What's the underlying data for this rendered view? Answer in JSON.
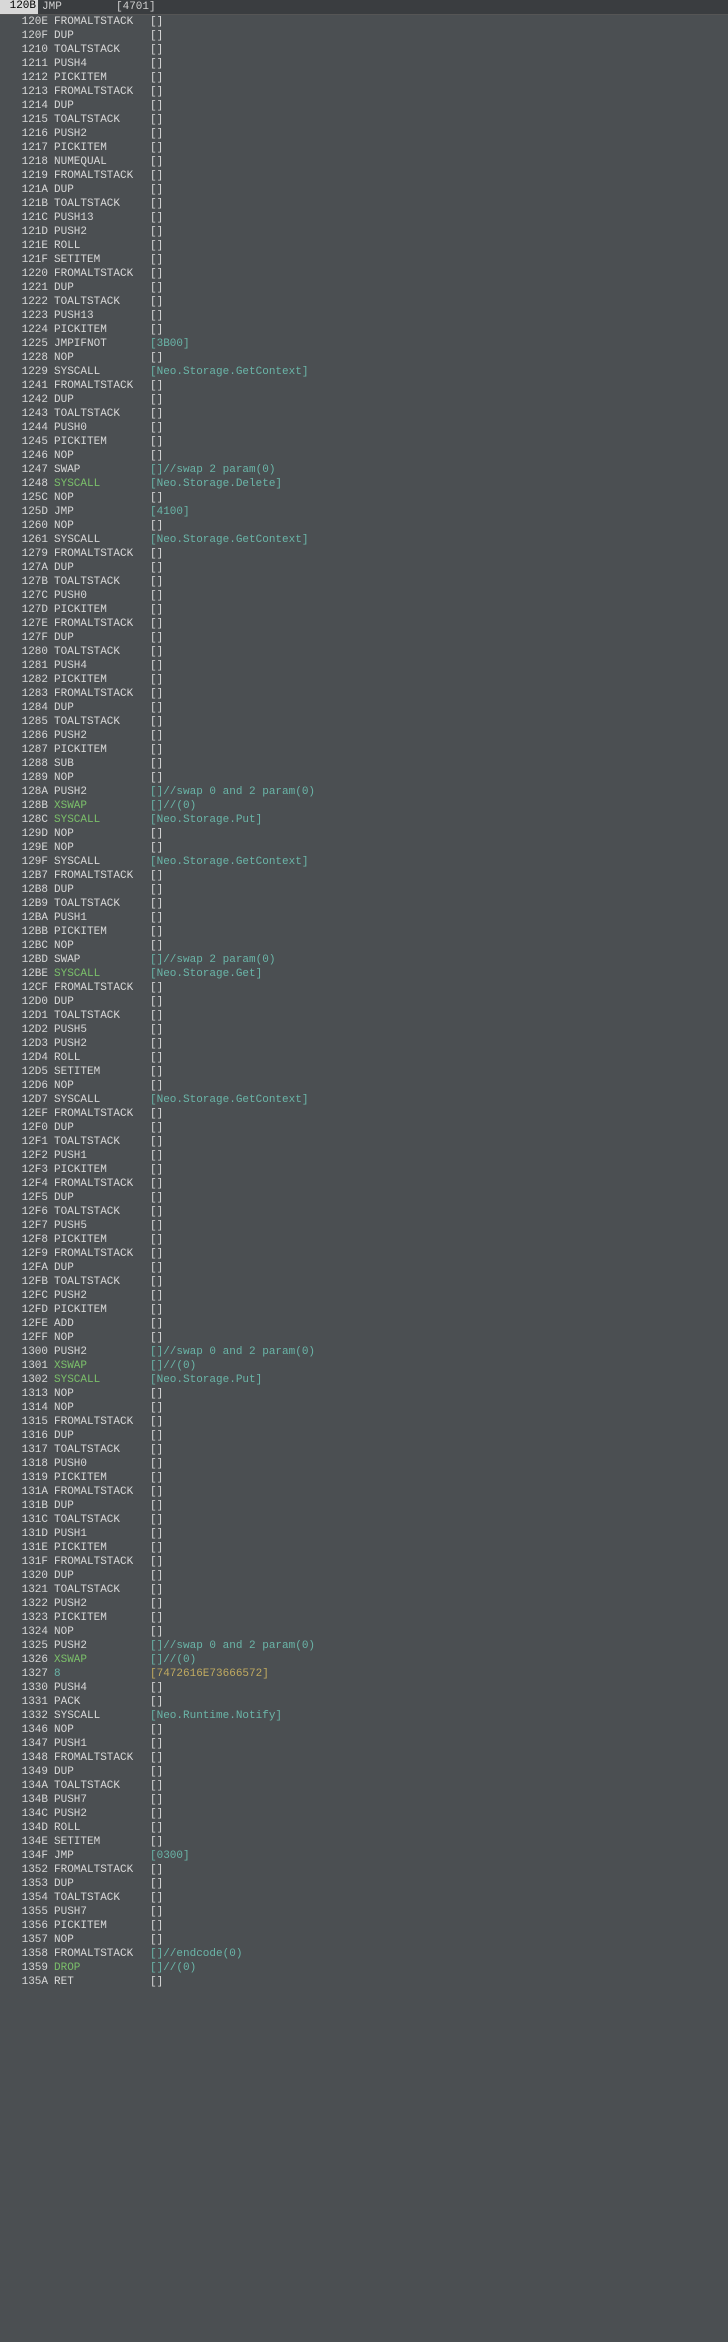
{
  "header": {
    "addr": "120B",
    "op": "JMP",
    "arg": "[4701]"
  },
  "rows": [
    {
      "addr": "120E",
      "op": "FROMALTSTACK",
      "arg": "[]"
    },
    {
      "addr": "120F",
      "op": "DUP",
      "arg": "[]"
    },
    {
      "addr": "1210",
      "op": "TOALTSTACK",
      "arg": "[]"
    },
    {
      "addr": "1211",
      "op": "PUSH4",
      "arg": "[]"
    },
    {
      "addr": "1212",
      "op": "PICKITEM",
      "arg": "[]"
    },
    {
      "addr": "1213",
      "op": "FROMALTSTACK",
      "arg": "[]"
    },
    {
      "addr": "1214",
      "op": "DUP",
      "arg": "[]"
    },
    {
      "addr": "1215",
      "op": "TOALTSTACK",
      "arg": "[]"
    },
    {
      "addr": "1216",
      "op": "PUSH2",
      "arg": "[]"
    },
    {
      "addr": "1217",
      "op": "PICKITEM",
      "arg": "[]"
    },
    {
      "addr": "1218",
      "op": "NUMEQUAL",
      "arg": "[]"
    },
    {
      "addr": "1219",
      "op": "FROMALTSTACK",
      "arg": "[]"
    },
    {
      "addr": "121A",
      "op": "DUP",
      "arg": "[]"
    },
    {
      "addr": "121B",
      "op": "TOALTSTACK",
      "arg": "[]"
    },
    {
      "addr": "121C",
      "op": "PUSH13",
      "arg": "[]"
    },
    {
      "addr": "121D",
      "op": "PUSH2",
      "arg": "[]"
    },
    {
      "addr": "121E",
      "op": "ROLL",
      "arg": "[]"
    },
    {
      "addr": "121F",
      "op": "SETITEM",
      "arg": "[]"
    },
    {
      "addr": "1220",
      "op": "FROMALTSTACK",
      "arg": "[]"
    },
    {
      "addr": "1221",
      "op": "DUP",
      "arg": "[]"
    },
    {
      "addr": "1222",
      "op": "TOALTSTACK",
      "arg": "[]"
    },
    {
      "addr": "1223",
      "op": "PUSH13",
      "arg": "[]"
    },
    {
      "addr": "1224",
      "op": "PICKITEM",
      "arg": "[]"
    },
    {
      "addr": "1225",
      "op": "JMPIFNOT",
      "arg": "[3B00]",
      "argClass": "teal"
    },
    {
      "addr": "1228",
      "op": "NOP",
      "arg": "[]"
    },
    {
      "addr": "1229",
      "op": "SYSCALL",
      "arg": "[Neo.Storage.GetContext]",
      "argClass": "teal"
    },
    {
      "addr": "1241",
      "op": "FROMALTSTACK",
      "arg": "[]"
    },
    {
      "addr": "1242",
      "op": "DUP",
      "arg": "[]"
    },
    {
      "addr": "1243",
      "op": "TOALTSTACK",
      "arg": "[]"
    },
    {
      "addr": "1244",
      "op": "PUSH0",
      "arg": "[]"
    },
    {
      "addr": "1245",
      "op": "PICKITEM",
      "arg": "[]"
    },
    {
      "addr": "1246",
      "op": "NOP",
      "arg": "[]"
    },
    {
      "addr": "1247",
      "op": "SWAP",
      "arg": "[]//swap 2 param(0)",
      "argClass": "teal"
    },
    {
      "addr": "1248",
      "op": "SYSCALL",
      "opClass": "green",
      "arg": "[Neo.Storage.Delete]",
      "argClass": "teal"
    },
    {
      "addr": "125C",
      "op": "NOP",
      "arg": "[]"
    },
    {
      "addr": "125D",
      "op": "JMP",
      "arg": "[4100]",
      "argClass": "teal"
    },
    {
      "addr": "1260",
      "op": "NOP",
      "arg": "[]"
    },
    {
      "addr": "1261",
      "op": "SYSCALL",
      "arg": "[Neo.Storage.GetContext]",
      "argClass": "teal"
    },
    {
      "addr": "1279",
      "op": "FROMALTSTACK",
      "arg": "[]"
    },
    {
      "addr": "127A",
      "op": "DUP",
      "arg": "[]"
    },
    {
      "addr": "127B",
      "op": "TOALTSTACK",
      "arg": "[]"
    },
    {
      "addr": "127C",
      "op": "PUSH0",
      "arg": "[]"
    },
    {
      "addr": "127D",
      "op": "PICKITEM",
      "arg": "[]"
    },
    {
      "addr": "127E",
      "op": "FROMALTSTACK",
      "arg": "[]"
    },
    {
      "addr": "127F",
      "op": "DUP",
      "arg": "[]"
    },
    {
      "addr": "1280",
      "op": "TOALTSTACK",
      "arg": "[]"
    },
    {
      "addr": "1281",
      "op": "PUSH4",
      "arg": "[]"
    },
    {
      "addr": "1282",
      "op": "PICKITEM",
      "arg": "[]"
    },
    {
      "addr": "1283",
      "op": "FROMALTSTACK",
      "arg": "[]"
    },
    {
      "addr": "1284",
      "op": "DUP",
      "arg": "[]"
    },
    {
      "addr": "1285",
      "op": "TOALTSTACK",
      "arg": "[]"
    },
    {
      "addr": "1286",
      "op": "PUSH2",
      "arg": "[]"
    },
    {
      "addr": "1287",
      "op": "PICKITEM",
      "arg": "[]"
    },
    {
      "addr": "1288",
      "op": "SUB",
      "arg": "[]"
    },
    {
      "addr": "1289",
      "op": "NOP",
      "arg": "[]"
    },
    {
      "addr": "128A",
      "op": "PUSH2",
      "arg": "[]//swap 0 and 2 param(0)",
      "argClass": "teal"
    },
    {
      "addr": "128B",
      "op": "XSWAP",
      "opClass": "green",
      "arg": "[]//(0)",
      "argClass": "teal"
    },
    {
      "addr": "128C",
      "op": "SYSCALL",
      "opClass": "green",
      "arg": "[Neo.Storage.Put]",
      "argClass": "teal"
    },
    {
      "addr": "129D",
      "op": "NOP",
      "arg": "[]"
    },
    {
      "addr": "129E",
      "op": "NOP",
      "arg": "[]"
    },
    {
      "addr": "129F",
      "op": "SYSCALL",
      "arg": "[Neo.Storage.GetContext]",
      "argClass": "teal"
    },
    {
      "addr": "12B7",
      "op": "FROMALTSTACK",
      "arg": "[]"
    },
    {
      "addr": "12B8",
      "op": "DUP",
      "arg": "[]"
    },
    {
      "addr": "12B9",
      "op": "TOALTSTACK",
      "arg": "[]"
    },
    {
      "addr": "12BA",
      "op": "PUSH1",
      "arg": "[]"
    },
    {
      "addr": "12BB",
      "op": "PICKITEM",
      "arg": "[]"
    },
    {
      "addr": "12BC",
      "op": "NOP",
      "arg": "[]"
    },
    {
      "addr": "12BD",
      "op": "SWAP",
      "arg": "[]//swap 2 param(0)",
      "argClass": "teal"
    },
    {
      "addr": "12BE",
      "op": "SYSCALL",
      "opClass": "green",
      "arg": "[Neo.Storage.Get]",
      "argClass": "teal"
    },
    {
      "addr": "12CF",
      "op": "FROMALTSTACK",
      "arg": "[]"
    },
    {
      "addr": "12D0",
      "op": "DUP",
      "arg": "[]"
    },
    {
      "addr": "12D1",
      "op": "TOALTSTACK",
      "arg": "[]"
    },
    {
      "addr": "12D2",
      "op": "PUSH5",
      "arg": "[]"
    },
    {
      "addr": "12D3",
      "op": "PUSH2",
      "arg": "[]"
    },
    {
      "addr": "12D4",
      "op": "ROLL",
      "arg": "[]"
    },
    {
      "addr": "12D5",
      "op": "SETITEM",
      "arg": "[]"
    },
    {
      "addr": "12D6",
      "op": "NOP",
      "arg": "[]"
    },
    {
      "addr": "12D7",
      "op": "SYSCALL",
      "arg": "[Neo.Storage.GetContext]",
      "argClass": "teal"
    },
    {
      "addr": "12EF",
      "op": "FROMALTSTACK",
      "arg": "[]"
    },
    {
      "addr": "12F0",
      "op": "DUP",
      "arg": "[]"
    },
    {
      "addr": "12F1",
      "op": "TOALTSTACK",
      "arg": "[]"
    },
    {
      "addr": "12F2",
      "op": "PUSH1",
      "arg": "[]"
    },
    {
      "addr": "12F3",
      "op": "PICKITEM",
      "arg": "[]"
    },
    {
      "addr": "12F4",
      "op": "FROMALTSTACK",
      "arg": "[]"
    },
    {
      "addr": "12F5",
      "op": "DUP",
      "arg": "[]"
    },
    {
      "addr": "12F6",
      "op": "TOALTSTACK",
      "arg": "[]"
    },
    {
      "addr": "12F7",
      "op": "PUSH5",
      "arg": "[]"
    },
    {
      "addr": "12F8",
      "op": "PICKITEM",
      "arg": "[]"
    },
    {
      "addr": "12F9",
      "op": "FROMALTSTACK",
      "arg": "[]"
    },
    {
      "addr": "12FA",
      "op": "DUP",
      "arg": "[]"
    },
    {
      "addr": "12FB",
      "op": "TOALTSTACK",
      "arg": "[]"
    },
    {
      "addr": "12FC",
      "op": "PUSH2",
      "arg": "[]"
    },
    {
      "addr": "12FD",
      "op": "PICKITEM",
      "arg": "[]"
    },
    {
      "addr": "12FE",
      "op": "ADD",
      "arg": "[]"
    },
    {
      "addr": "12FF",
      "op": "NOP",
      "arg": "[]"
    },
    {
      "addr": "1300",
      "op": "PUSH2",
      "arg": "[]//swap 0 and 2 param(0)",
      "argClass": "teal"
    },
    {
      "addr": "1301",
      "op": "XSWAP",
      "opClass": "green",
      "arg": "[]//(0)",
      "argClass": "teal"
    },
    {
      "addr": "1302",
      "op": "SYSCALL",
      "opClass": "green",
      "arg": "[Neo.Storage.Put]",
      "argClass": "teal"
    },
    {
      "addr": "1313",
      "op": "NOP",
      "arg": "[]"
    },
    {
      "addr": "1314",
      "op": "NOP",
      "arg": "[]"
    },
    {
      "addr": "1315",
      "op": "FROMALTSTACK",
      "arg": "[]"
    },
    {
      "addr": "1316",
      "op": "DUP",
      "arg": "[]"
    },
    {
      "addr": "1317",
      "op": "TOALTSTACK",
      "arg": "[]"
    },
    {
      "addr": "1318",
      "op": "PUSH0",
      "arg": "[]"
    },
    {
      "addr": "1319",
      "op": "PICKITEM",
      "arg": "[]"
    },
    {
      "addr": "131A",
      "op": "FROMALTSTACK",
      "arg": "[]"
    },
    {
      "addr": "131B",
      "op": "DUP",
      "arg": "[]"
    },
    {
      "addr": "131C",
      "op": "TOALTSTACK",
      "arg": "[]"
    },
    {
      "addr": "131D",
      "op": "PUSH1",
      "arg": "[]"
    },
    {
      "addr": "131E",
      "op": "PICKITEM",
      "arg": "[]"
    },
    {
      "addr": "131F",
      "op": "FROMALTSTACK",
      "arg": "[]"
    },
    {
      "addr": "1320",
      "op": "DUP",
      "arg": "[]"
    },
    {
      "addr": "1321",
      "op": "TOALTSTACK",
      "arg": "[]"
    },
    {
      "addr": "1322",
      "op": "PUSH2",
      "arg": "[]"
    },
    {
      "addr": "1323",
      "op": "PICKITEM",
      "arg": "[]"
    },
    {
      "addr": "1324",
      "op": "NOP",
      "arg": "[]"
    },
    {
      "addr": "1325",
      "op": "PUSH2",
      "arg": "[]//swap 0 and 2 param(0)",
      "argClass": "teal"
    },
    {
      "addr": "1326",
      "op": "XSWAP",
      "opClass": "green",
      "arg": "[]//(0)",
      "argClass": "teal"
    },
    {
      "addr": "1327",
      "op": "8",
      "opClass": "teal",
      "arg": "[7472616E73666572]",
      "argClass": "yellow"
    },
    {
      "addr": "1330",
      "op": "PUSH4",
      "arg": "[]"
    },
    {
      "addr": "1331",
      "op": "PACK",
      "arg": "[]"
    },
    {
      "addr": "1332",
      "op": "SYSCALL",
      "arg": "[Neo.Runtime.Notify]",
      "argClass": "teal"
    },
    {
      "addr": "1346",
      "op": "NOP",
      "arg": "[]"
    },
    {
      "addr": "1347",
      "op": "PUSH1",
      "arg": "[]"
    },
    {
      "addr": "1348",
      "op": "FROMALTSTACK",
      "arg": "[]"
    },
    {
      "addr": "1349",
      "op": "DUP",
      "arg": "[]"
    },
    {
      "addr": "134A",
      "op": "TOALTSTACK",
      "arg": "[]"
    },
    {
      "addr": "134B",
      "op": "PUSH7",
      "arg": "[]"
    },
    {
      "addr": "134C",
      "op": "PUSH2",
      "arg": "[]"
    },
    {
      "addr": "134D",
      "op": "ROLL",
      "arg": "[]"
    },
    {
      "addr": "134E",
      "op": "SETITEM",
      "arg": "[]"
    },
    {
      "addr": "134F",
      "op": "JMP",
      "arg": "[0300]",
      "argClass": "teal"
    },
    {
      "addr": "1352",
      "op": "FROMALTSTACK",
      "arg": "[]"
    },
    {
      "addr": "1353",
      "op": "DUP",
      "arg": "[]"
    },
    {
      "addr": "1354",
      "op": "TOALTSTACK",
      "arg": "[]"
    },
    {
      "addr": "1355",
      "op": "PUSH7",
      "arg": "[]"
    },
    {
      "addr": "1356",
      "op": "PICKITEM",
      "arg": "[]"
    },
    {
      "addr": "1357",
      "op": "NOP",
      "arg": "[]"
    },
    {
      "addr": "1358",
      "op": "FROMALTSTACK",
      "arg": "[]//endcode(0)",
      "argClass": "teal"
    },
    {
      "addr": "1359",
      "op": "DROP",
      "opClass": "green",
      "arg": "[]//(0)",
      "argClass": "teal"
    },
    {
      "addr": "135A",
      "op": "RET",
      "arg": "[]"
    }
  ]
}
